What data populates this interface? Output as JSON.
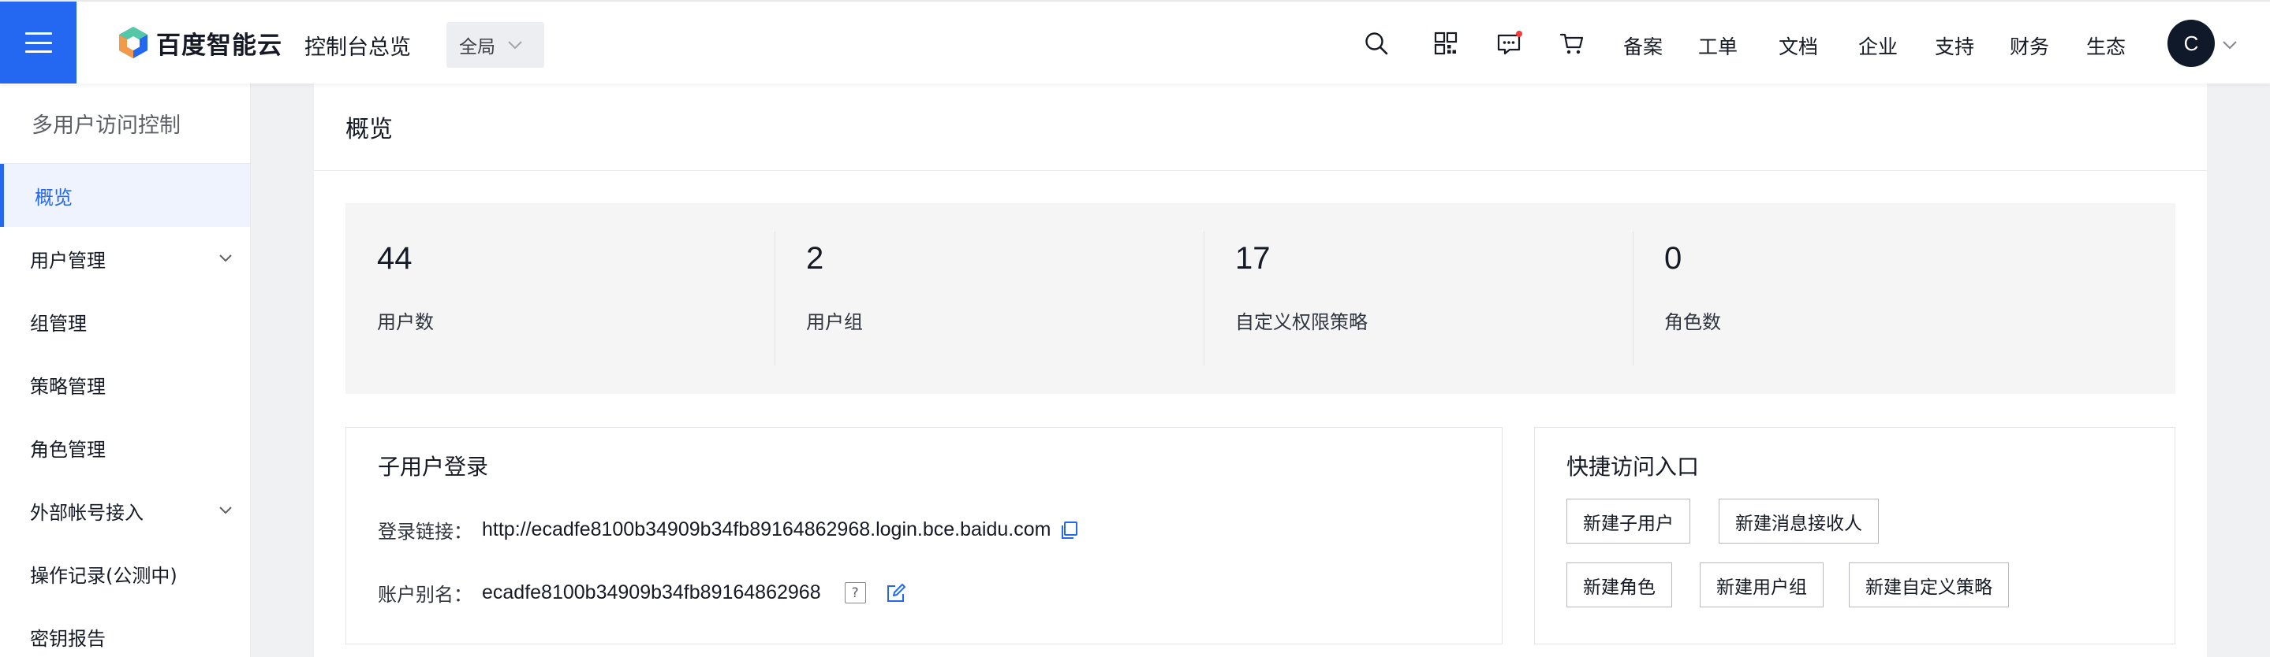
{
  "header": {
    "logo_text": "百度智能云",
    "console_title": "控制台总览",
    "region": "全局",
    "nav_links": [
      "备案",
      "工单",
      "文档",
      "企业",
      "支持",
      "财务",
      "生态"
    ],
    "avatar_initial": "C",
    "icons": [
      "search-icon",
      "qrcode-icon",
      "message-icon",
      "cart-icon"
    ],
    "accent_color": "#2468f2",
    "notification_dot_color": "#f33e3e"
  },
  "sidebar": {
    "title": "多用户访问控制",
    "items": [
      {
        "label": "概览",
        "active": true
      },
      {
        "label": "用户管理",
        "expandable": true
      },
      {
        "label": "组管理"
      },
      {
        "label": "策略管理"
      },
      {
        "label": "角色管理"
      },
      {
        "label": "外部帐号接入",
        "expandable": true
      },
      {
        "label": "操作记录(公测中)"
      },
      {
        "label": "密钥报告"
      }
    ]
  },
  "main": {
    "title": "概览",
    "stats": [
      {
        "value": "44",
        "label": "用户数"
      },
      {
        "value": "2",
        "label": "用户组"
      },
      {
        "value": "17",
        "label": "自定义权限策略"
      },
      {
        "value": "0",
        "label": "角色数"
      }
    ],
    "login_card": {
      "title": "子用户登录",
      "login_link_label": "登录链接：",
      "login_link": "http://ecadfe8100b34909b34fb89164862968.login.bce.baidu.com",
      "alias_label": "账户别名：",
      "alias": "ecadfe8100b34909b34fb89164862968",
      "help_glyph": "?"
    },
    "quick_card": {
      "title": "快捷访问入口",
      "buttons": [
        "新建子用户",
        "新建消息接收人",
        "新建角色",
        "新建用户组",
        "新建自定义策略"
      ]
    }
  }
}
